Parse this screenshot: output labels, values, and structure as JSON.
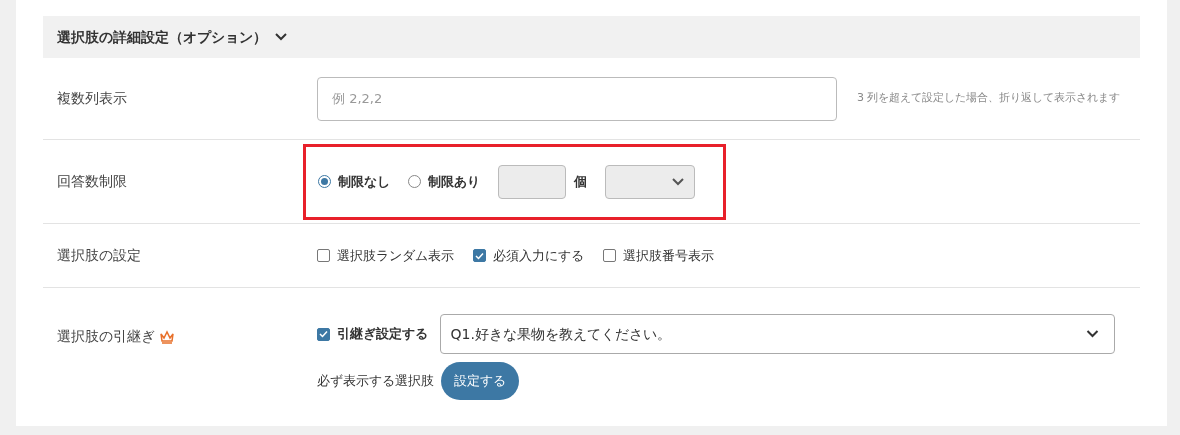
{
  "section": {
    "title": "選択肢の詳細設定（オプション）",
    "expanded": true
  },
  "rows": [
    {
      "kind": "text-input",
      "label": "複数列表示",
      "highlighted": false,
      "placeholder": "例 2,2,2",
      "hint": "3 列を超えて設定した場合、折り返して表示されます"
    },
    {
      "kind": "radio",
      "label": "回答数制限",
      "highlighted": true,
      "options": [
        {
          "label": "制限なし",
          "selected": true
        },
        {
          "label": "制限あり",
          "selected": false
        }
      ],
      "unit": "個"
    },
    {
      "kind": "checkboxes",
      "label": "選択肢の設定",
      "highlighted": false,
      "options": [
        {
          "label": "選択肢ランダム表示",
          "checked": false
        },
        {
          "label": "必須入力にする",
          "checked": true
        },
        {
          "label": "選択肢番号表示",
          "checked": false
        }
      ]
    },
    {
      "kind": "inherit",
      "label": "選択肢の引継ぎ",
      "premium": true,
      "highlighted": false,
      "checkbox": {
        "label": "引継ぎ設定する",
        "checked": true
      },
      "select_value": "Q1.好きな果物を教えてください。",
      "sub_label": "必ず表示する選択肢",
      "button": "設定する"
    }
  ]
}
